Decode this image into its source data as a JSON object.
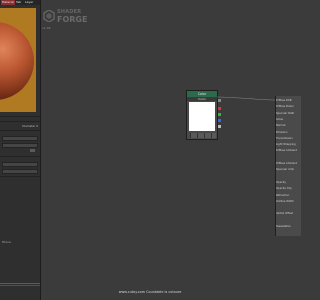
{
  "titlebar": {
    "tabs": [
      "Material",
      "Tab",
      "Layer"
    ]
  },
  "left_panel": {
    "value_label": "Diameter 0",
    "button_label": "Edit",
    "bottom_text": "Phone"
  },
  "logo": {
    "line1": "SHADER",
    "line2": "FORGE",
    "version": "v1.38"
  },
  "color_node": {
    "title": "Color",
    "subtitle": "Color",
    "swatch_color": "#ffffff",
    "outputs": [
      "RGB",
      "R",
      "G",
      "B",
      "A"
    ],
    "output_colors": [
      "#888888",
      "#d23a3a",
      "#3ab04a",
      "#3a6ad8",
      "#bbbbbb"
    ]
  },
  "main_node": {
    "rows": [
      "Diffuse RGB",
      "Diffuse Power",
      "Specular RGB",
      "Gloss",
      "Normal",
      "Emission",
      "Transmission",
      "Light Wrapping",
      "Diffuse Ambient",
      "",
      "Diffuse Ambient",
      "Specular Amb",
      "",
      "Opacity",
      "Opacity Clip",
      "Refraction",
      "Outline Width",
      "",
      "Vertex Offset",
      "",
      "Tessellation"
    ]
  },
  "footer": {
    "text": "www.cutoy.com Countable is cutoure"
  }
}
